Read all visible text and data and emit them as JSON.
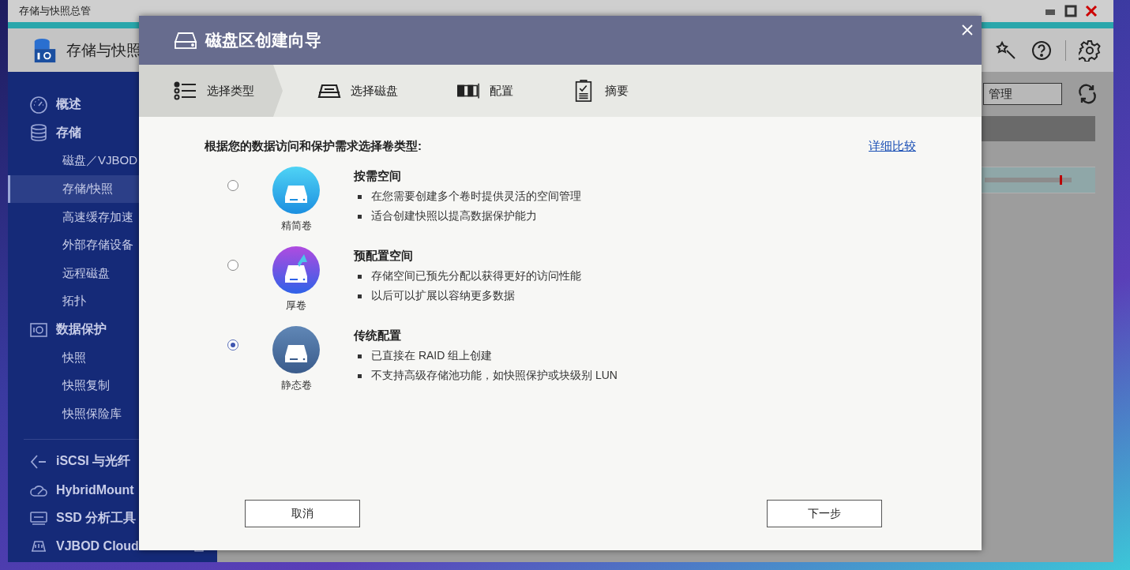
{
  "app": {
    "title": "存储与快照总管",
    "header_title": "存储与快照",
    "manage_field": "管理"
  },
  "sidebar": {
    "nav": [
      {
        "kind": "heading",
        "label": "概述",
        "selected": false
      },
      {
        "kind": "heading",
        "label": "存储",
        "selected": false
      },
      {
        "kind": "sub",
        "label": "磁盘／VJBOD",
        "selected": false
      },
      {
        "kind": "sub",
        "label": "存储/快照",
        "selected": true
      },
      {
        "kind": "sub",
        "label": "高速缓存加速",
        "selected": false
      },
      {
        "kind": "sub",
        "label": "外部存储设备",
        "selected": false
      },
      {
        "kind": "sub",
        "label": "远程磁盘",
        "selected": false
      },
      {
        "kind": "sub",
        "label": "拓扑",
        "selected": false
      },
      {
        "kind": "heading",
        "label": "数据保护",
        "selected": false
      },
      {
        "kind": "sub",
        "label": "快照",
        "selected": false
      },
      {
        "kind": "sub",
        "label": "快照复制",
        "selected": false
      },
      {
        "kind": "sub",
        "label": "快照保险库",
        "selected": false
      }
    ],
    "tools": [
      {
        "label": "iSCSI 与光纤",
        "selected": false
      },
      {
        "label": "HybridMount",
        "selected": false
      },
      {
        "label": "SSD 分析工具",
        "selected": false
      },
      {
        "label": "VJBOD Cloud",
        "selected": false
      }
    ]
  },
  "dialog": {
    "title": "磁盘区创建向导",
    "steps": [
      {
        "label": "选择类型",
        "selected": true
      },
      {
        "label": "选择磁盘",
        "selected": false
      },
      {
        "label": "配置",
        "selected": false
      },
      {
        "label": "摘要",
        "selected": false
      }
    ],
    "prompt": "根据您的数据访问和保护需求选择卷类型:",
    "compare_link": "详细比较",
    "options": [
      {
        "title": "按需空间",
        "icon_label": "精简卷",
        "selected": false,
        "bullets": [
          "在您需要创建多个卷时提供灵活的空间管理",
          "适合创建快照以提高数据保护能力"
        ]
      },
      {
        "title": "预配置空间",
        "icon_label": "厚卷",
        "selected": false,
        "bullets": [
          "存储空间已预先分配以获得更好的访问性能",
          "以后可以扩展以容纳更多数据"
        ]
      },
      {
        "title": "传统配置",
        "icon_label": "静态卷",
        "selected": true,
        "bullets": [
          "已直接在 RAID 组上创建",
          "不支持高级存储池功能，如快照保护或块级别 LUN"
        ]
      }
    ],
    "buttons": {
      "cancel": "取消",
      "next": "下一步"
    }
  }
}
